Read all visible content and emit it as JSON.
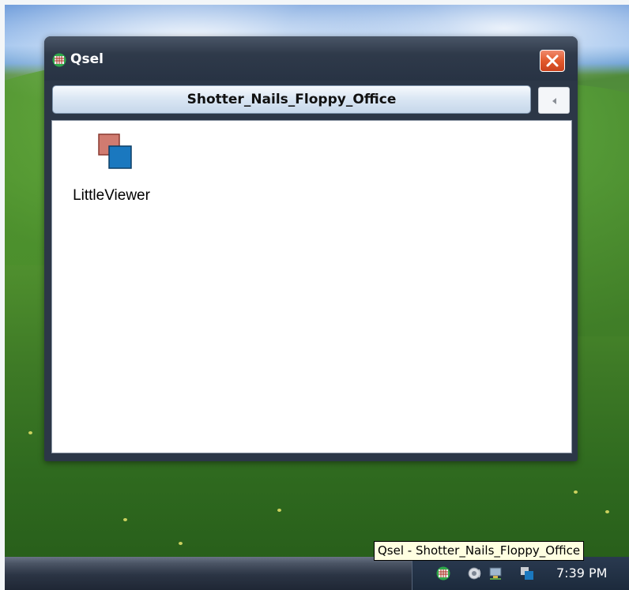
{
  "window": {
    "title": "Qsel",
    "location": "Shotter_Nails_Floppy_Office",
    "icon": "qsel-grid-icon",
    "close_icon": "close-icon",
    "back_icon": "left-arrow-icon"
  },
  "items": [
    {
      "label": "LittleViewer",
      "icon": "littleviewer-icon"
    }
  ],
  "tooltip": {
    "text": "Qsel - Shotter_Nails_Floppy_Office"
  },
  "taskbar": {
    "tray_icons": [
      "qsel-grid-icon",
      "speaker-icon",
      "network-icon",
      "littleviewer-icon"
    ],
    "clock": "7:39 PM"
  },
  "colors": {
    "window_frame": "#2c3747",
    "close_button": "#e35a2c",
    "location_bar": "#dbe7f4",
    "tooltip_bg": "#ffffe1",
    "icon_back_square": "#d07b70",
    "icon_front_square": "#1a78bf"
  }
}
